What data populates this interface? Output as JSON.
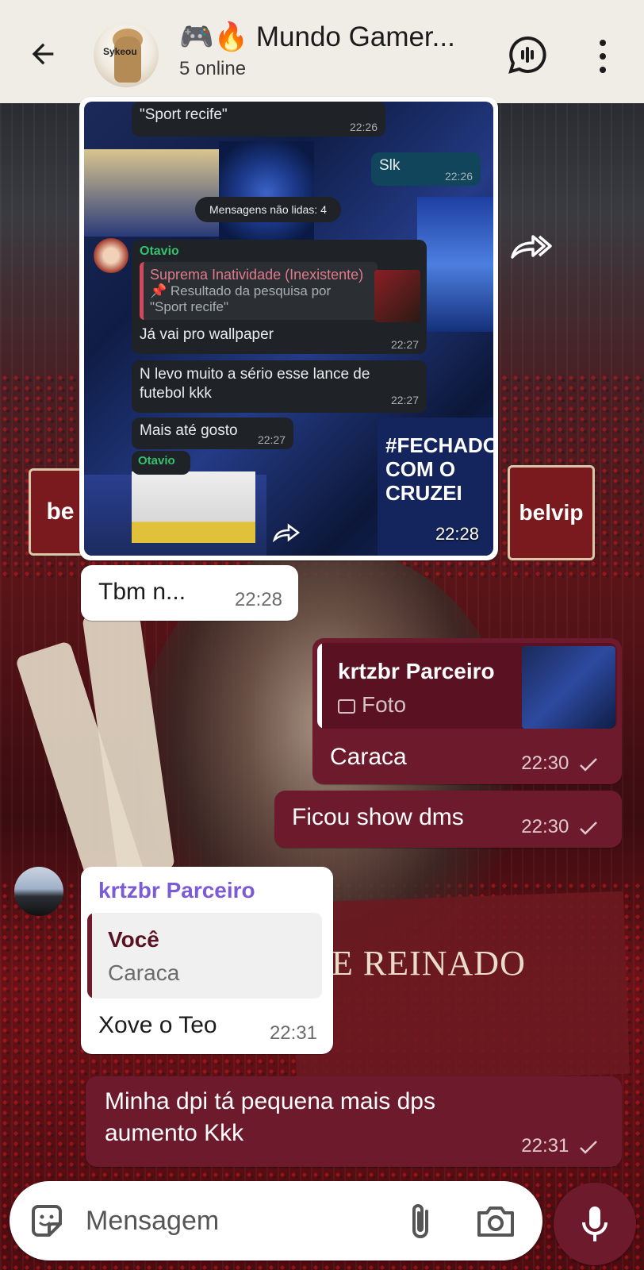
{
  "header": {
    "back_icon": "arrow-left-icon",
    "avatar_text": "Sykeou",
    "title": "🎮🔥 Mundo Gamer...",
    "subtitle": "5 online",
    "voice_chat_icon": "voice-chat-icon",
    "menu_icon": "more-vert-icon"
  },
  "forwarded_image": {
    "time": "22:28",
    "screenshot": {
      "top_quote": "\"Sport recife\"",
      "top_quote_time": "22:26",
      "slk": "Slk",
      "slk_time": "22:26",
      "unread": "Mensagens não lidas: 4",
      "sender": "Otavio",
      "reply_name": "Suprema Inatividade (Inexistente)",
      "reply_text": "📌 Resultado da pesquisa por \"Sport recife\"",
      "msg1": "Já vai pro wallpaper",
      "msg1_time": "22:27",
      "msg2": "N levo muito a sério esse lance de futebol kkk",
      "msg2_time": "22:27",
      "msg3": "Mais até gosto",
      "msg3_time": "22:27",
      "sender2": "Otavio",
      "poster_text": "#FECHADO COM O CRUZEI"
    }
  },
  "messages": [
    {
      "id": "m1",
      "dir": "in",
      "text": "Tbm n...",
      "time": "22:28"
    },
    {
      "id": "m2",
      "dir": "out",
      "quote_name": "krtzbr Parceiro",
      "quote_preview": "Foto",
      "text": "Caraca",
      "time": "22:30"
    },
    {
      "id": "m3",
      "dir": "out",
      "text": "Ficou show dms",
      "time": "22:30"
    },
    {
      "id": "m4",
      "dir": "in",
      "sender": "krtzbr Parceiro",
      "quote_name": "Você",
      "quote_preview": "Caraca",
      "text": "Xove o Teo",
      "time": "22:31"
    },
    {
      "id": "m5",
      "dir": "out",
      "text": "Minha dpi tá pequena mais dps aumento Kkk",
      "time": "22:31"
    }
  ],
  "wallpaper": {
    "banner_left": "be",
    "banner_right": "belvip",
    "cloth_text": "E REINADO"
  },
  "input": {
    "placeholder": "Mensagem",
    "sticker_icon": "sticker-icon",
    "attach_icon": "paperclip-icon",
    "camera_icon": "camera-icon",
    "mic_icon": "mic-icon"
  },
  "colors": {
    "header_bg": "#f0ede6",
    "outgoing_bubble": "#6e1a2d",
    "incoming_bubble": "#ffffff",
    "sender_name": "#7b5bd6"
  }
}
